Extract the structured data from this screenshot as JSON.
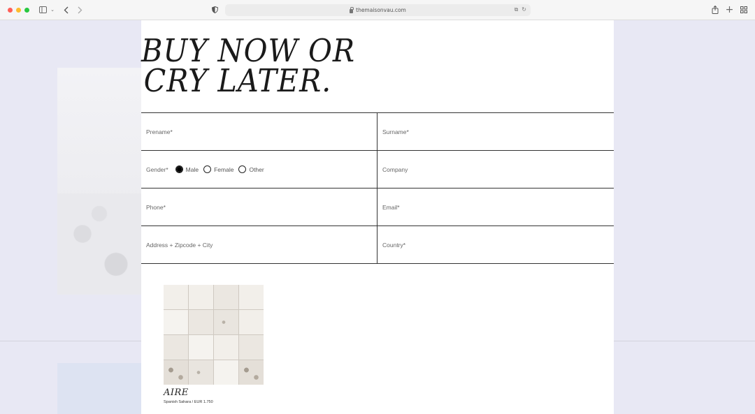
{
  "browser": {
    "url": "themaisonvau.com",
    "icons": {
      "sidebar": "sidebar-icon",
      "back": "chevron-left-icon",
      "forward": "chevron-right-icon",
      "shield": "shield-icon",
      "translate": "translate-icon",
      "reload": "reload-icon",
      "share": "share-icon",
      "new_tab": "plus-icon",
      "tabs": "tab-grid-icon"
    }
  },
  "page": {
    "headline": {
      "line1": "BUY NOW OR",
      "line2": "CRY LATER."
    },
    "form": {
      "prename_placeholder": "Prename*",
      "surname_placeholder": "Surname*",
      "gender_label": "Gender*",
      "gender_options": [
        "Male",
        "Female",
        "Other"
      ],
      "gender_selected": "Male",
      "company_placeholder": "Company",
      "phone_placeholder": "Phone*",
      "email_placeholder": "Email*",
      "address_placeholder": "Address + Zipcode + City",
      "country_placeholder": "Country*"
    },
    "product": {
      "name": "AIRE",
      "meta": "Spanish Sahara / EUR 1.750"
    }
  },
  "colors": {
    "page_bg": "#e8e8f4",
    "panel_bg": "#ffffff",
    "line": "#333333"
  }
}
